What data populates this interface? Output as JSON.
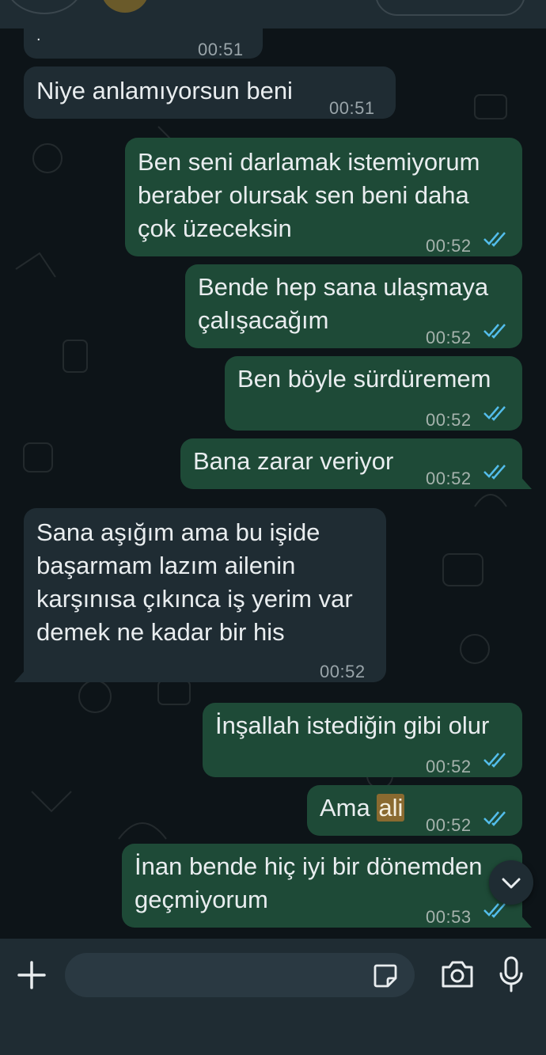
{
  "messages": [
    {
      "direction": "in",
      "text": ".",
      "time": "00:51"
    },
    {
      "direction": "in",
      "text": "Niye anlamıyorsun beni",
      "time": "00:51"
    },
    {
      "direction": "out",
      "lines": [
        "Ben seni darlamak istemiyorum",
        "beraber olursak sen beni daha",
        "çok üzeceksin"
      ],
      "time": "00:52",
      "status": "read"
    },
    {
      "direction": "out",
      "lines": [
        "Bende hep sana ulaşmaya",
        "çalışacağım"
      ],
      "time": "00:52",
      "status": "read"
    },
    {
      "direction": "out",
      "text": "Ben böyle sürdüremem",
      "time": "00:52",
      "status": "read"
    },
    {
      "direction": "out",
      "text": "Bana zarar veriyor",
      "time": "00:52",
      "status": "read"
    },
    {
      "direction": "in",
      "lines": [
        "Sana aşığım ama bu işide",
        "başarmam lazım ailenin",
        "karşınısa çıkınca iş yerim var",
        "demek ne kadar bir his"
      ],
      "time": "00:52"
    },
    {
      "direction": "out",
      "text": "İnşallah istediğin gibi olur",
      "time": "00:52",
      "status": "read"
    },
    {
      "direction": "out",
      "text_before": "Ama ",
      "text_highlight": "ali",
      "time": "00:52",
      "status": "read"
    },
    {
      "direction": "out",
      "lines": [
        "İnan bende hiç iyi bir dönemden",
        "geçmiyorum"
      ],
      "time": "00:53",
      "status": "read"
    }
  ],
  "colors": {
    "background": "#0d1418",
    "incoming_bubble": "#1f2c33",
    "outgoing_bubble": "#1e4a37",
    "read_ticks": "#53bdeb",
    "highlight": "#8a6a30"
  },
  "icons": {
    "add": "plus-icon",
    "sticker": "sticker-icon",
    "camera": "camera-icon",
    "mic": "microphone-icon",
    "scroll": "chevron-down-icon",
    "status": "double-check-icon"
  }
}
